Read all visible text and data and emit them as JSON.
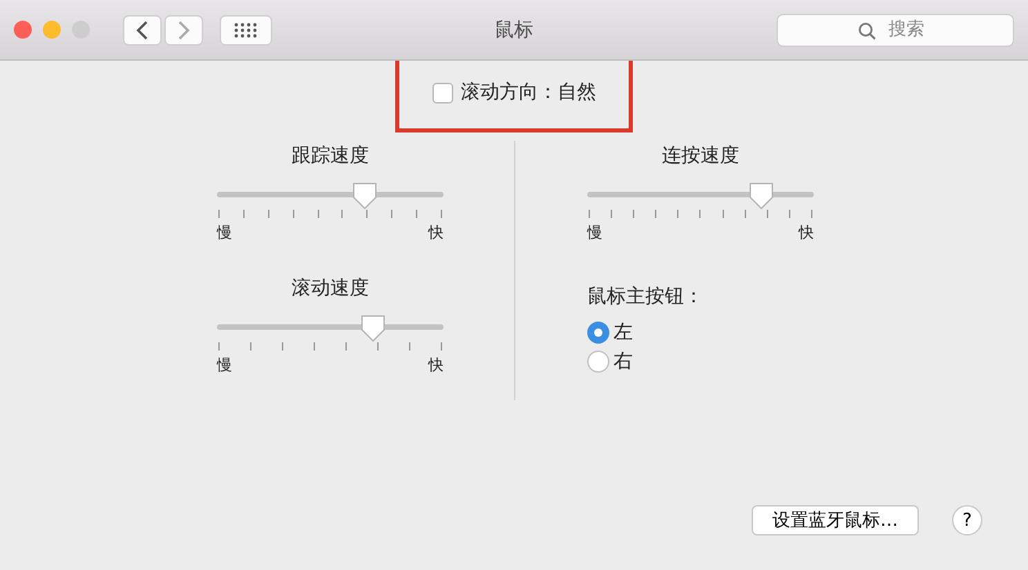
{
  "window": {
    "title": "鼠标",
    "search": {
      "placeholder": "搜索"
    }
  },
  "scroll_direction": {
    "label": "滚动方向：自然",
    "checked": false,
    "highlighted": true
  },
  "left_sliders": [
    {
      "title": "跟踪速度",
      "level": 0.65,
      "min_label": "慢",
      "max_label": "快"
    },
    {
      "title": "滚动速度",
      "level": 0.69,
      "min_label": "慢",
      "max_label": "快"
    }
  ],
  "right_slider": {
    "title": "连按速度",
    "level": 0.77,
    "min_label": "慢",
    "max_label": "快"
  },
  "primary_button": {
    "title": "鼠标主按钮：",
    "options": [
      {
        "label": "左",
        "selected": true
      },
      {
        "label": "右",
        "selected": false
      }
    ]
  },
  "footer": {
    "button": "设置蓝牙鼠标…",
    "help": "?"
  }
}
